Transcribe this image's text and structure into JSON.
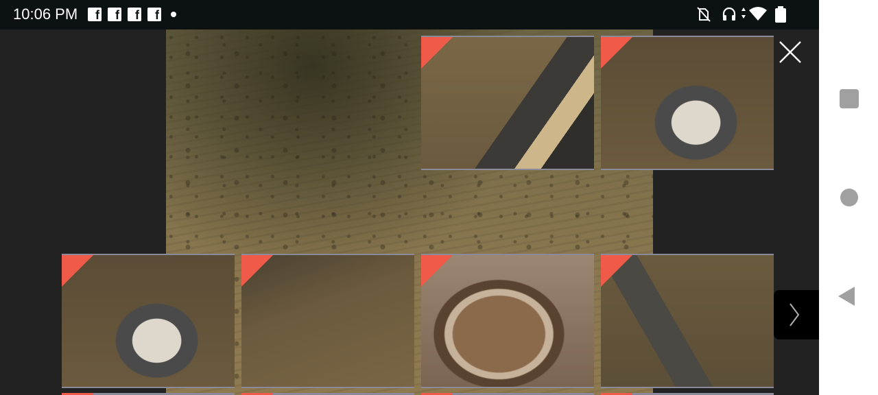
{
  "status_bar": {
    "time": "10:06 PM",
    "notification_icons": [
      "facebook-icon",
      "facebook-icon",
      "facebook-icon",
      "facebook-icon"
    ],
    "right_icons": [
      "no-sim-icon",
      "headphones-icon",
      "wifi-icon",
      "battery-icon"
    ]
  },
  "navigation": {
    "buttons": [
      "recents-button",
      "home-button",
      "back-button"
    ]
  },
  "viewer": {
    "main_image": "mars-surface-photo",
    "top_thumbnails": [
      "rover-arm-photo",
      "rover-wheel-photo"
    ],
    "bottom_thumbnails": [
      "rover-deck-photo",
      "mars-ground-photo",
      "rover-hatch-photo",
      "rover-arm-ground-photo"
    ],
    "flag_color": "#f05a48",
    "close_icon": "close-icon",
    "next_icon": "chevron-right-icon"
  }
}
